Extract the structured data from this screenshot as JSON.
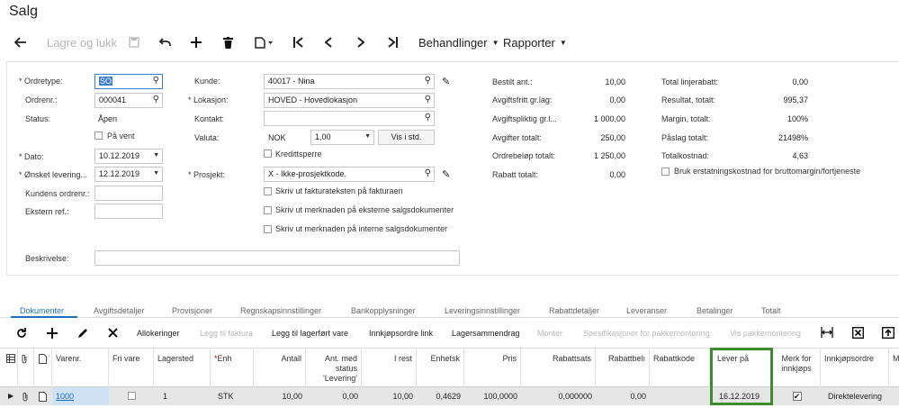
{
  "page": {
    "title": "Salg"
  },
  "toolbar": {
    "save_close": "Lagre og lukk",
    "actions": "Behandlinger",
    "reports": "Rapporter"
  },
  "form": {
    "order_type": {
      "label": "Ordretype:",
      "value": "SO"
    },
    "order_nbr": {
      "label": "Ordrenr.:",
      "value": "000041"
    },
    "status": {
      "label": "Status:",
      "value": "Åpen"
    },
    "on_hold": {
      "label": "På vent"
    },
    "date": {
      "label": "Dato:",
      "value": "10.12.2019"
    },
    "requested": {
      "label": "Ønsket levering...",
      "value": "12.12.2019"
    },
    "customer_order": {
      "label": "Kundens ordrenr.:",
      "value": ""
    },
    "external_ref": {
      "label": "Ekstern ref.:",
      "value": ""
    },
    "customer": {
      "label": "Kunde:",
      "value": "40017 - Nina"
    },
    "location": {
      "label": "Lokasjon:",
      "value": "HOVED - Hovedlokasjon"
    },
    "contact": {
      "label": "Kontakt:",
      "value": ""
    },
    "currency": {
      "label": "Valuta:",
      "code": "NOK",
      "rate": "1,00",
      "button": "Vis i std."
    },
    "credit_hold": {
      "label": "Kredittsperre"
    },
    "project": {
      "label": "Prosjekt:",
      "value": "X - Ikke-prosjektkode."
    },
    "print_invoice_text": {
      "label": "Skriv ut fakturateksten på fakturaen"
    },
    "print_note_external": {
      "label": "Skriv ut merknaden på eksterne salgsdokumenter"
    },
    "print_note_internal": {
      "label": "Skriv ut merknaden på interne salgsdokumenter"
    },
    "description": {
      "label": "Beskrivelse:",
      "value": ""
    },
    "summary_mid": [
      {
        "label": "Bestilt ant.:",
        "value": "10,00"
      },
      {
        "label": "Avgiftsfritt gr.lag:",
        "value": "0,00"
      },
      {
        "label": "Avgiftspliktig gr.l...",
        "value": "1 000,00"
      },
      {
        "label": "Avgifter totalt:",
        "value": "250,00"
      },
      {
        "label": "Ordrebeløp totalt:",
        "value": "1 250,00"
      },
      {
        "label": "Rabatt totalt:",
        "value": "0,00"
      }
    ],
    "summary_right": [
      {
        "label": "Total linjerabatt:",
        "value": "0,00"
      },
      {
        "label": "Resultat, totalt:",
        "value": "995,37"
      },
      {
        "label": "Margin, totalt:",
        "value": "100%"
      },
      {
        "label": "Påslag totalt:",
        "value": "21498%"
      },
      {
        "label": "Totalkostnad:",
        "value": "4,63"
      }
    ],
    "use_replacement_cost": {
      "label": "Bruk erstatningskostnad for bruttomargin/fortjeneste"
    }
  },
  "tabs": [
    "Dokumenter",
    "Avgiftsdetaljer",
    "Provisjoner",
    "Regnskapsinnstillinger",
    "Bankopplysninger",
    "Leveringsinnstillinger",
    "Rabattdetaljer",
    "Leveranser",
    "Betalinger",
    "Totalt"
  ],
  "grid_toolbar": {
    "allocations": "Allokeringer",
    "add_invoice": "Legg til faktura",
    "add_stock": "Legg til lagerført vare",
    "po_link": "Innkjøpsordre link",
    "inventory_summary": "Lagersammendrag",
    "configure": "Montér",
    "packaging_spec": "Spesifikasjoner for pakkemontering",
    "show_packaging": "Vis pakkemontering"
  },
  "grid": {
    "headers": {
      "item": "Varenr.",
      "free_item": "Fri vare",
      "warehouse": "Lagersted",
      "uom": "Enh",
      "qty": "Antall",
      "qty_shipped": "Ant. med status 'Levering'",
      "open_qty": "I rest",
      "unit_cost": "Enhetsk",
      "price": "Pris",
      "discount_pct": "Rabattsats",
      "discount_amt": "Rabattbelı",
      "discount_code": "Rabattkode",
      "ship_on": "Lever på",
      "mark_po": "Merk for innkjøps",
      "po_source": "Innkjøpsordre",
      "extra": "M"
    },
    "row": {
      "item": "1000",
      "warehouse": "1",
      "uom": "STK",
      "qty": "10,00",
      "qty_shipped": "0,00",
      "open_qty": "10,00",
      "unit_cost": "0,4629",
      "price": "100,0000",
      "discount_pct": "0,000000",
      "discount_amt": "0,00",
      "ship_on": "16.12.2019",
      "po_source": "Direktelevering"
    }
  }
}
